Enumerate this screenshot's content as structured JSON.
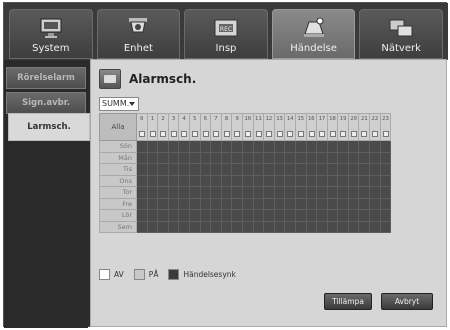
{
  "top_tabs": [
    {
      "label": "System",
      "icon": "monitor-icon",
      "active": false
    },
    {
      "label": "Enhet",
      "icon": "camera-icon",
      "active": false
    },
    {
      "label": "Insp",
      "icon": "rec-icon",
      "active": false
    },
    {
      "label": "Händelse",
      "icon": "event-icon",
      "active": true
    },
    {
      "label": "Nätverk",
      "icon": "network-icon",
      "active": false
    }
  ],
  "sidebar": {
    "items": [
      {
        "label": "Rörelselarm"
      },
      {
        "label": "Sign.avbr."
      },
      {
        "label": "Larmsch."
      }
    ]
  },
  "panel": {
    "title": "Alarmsch.",
    "season_select": "SUMM.",
    "corner_label": "Alla",
    "hours": [
      "0",
      "1",
      "2",
      "3",
      "4",
      "5",
      "6",
      "7",
      "8",
      "9",
      "10",
      "11",
      "12",
      "13",
      "14",
      "15",
      "16",
      "17",
      "18",
      "19",
      "20",
      "21",
      "22",
      "23"
    ],
    "days": [
      "Sön",
      "Mån",
      "Tis",
      "Ons",
      "Tor",
      "Fre",
      "Lör",
      "Sem"
    ]
  },
  "legend": {
    "off_label": "AV",
    "on_label": "PÅ",
    "sync_label": "Händelsesynk"
  },
  "buttons": {
    "apply": "Tillämpa",
    "cancel": "Avbryt"
  },
  "colors": {
    "active_tab": "#7a7a7a",
    "grid_sync": "#4a4a4a",
    "panel_bg": "#d6d6d6"
  }
}
